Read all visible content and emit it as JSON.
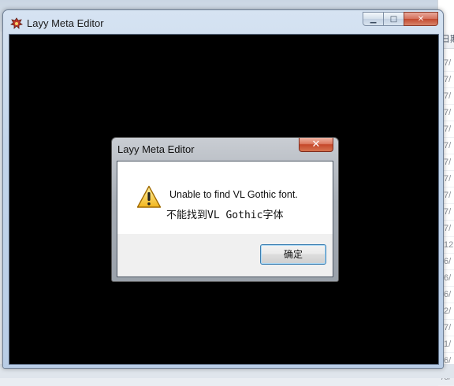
{
  "background": {
    "list_header": "日期",
    "list_rows": [
      "/7/",
      "/7/",
      "/7/",
      "/7/",
      "/7/",
      "/7/",
      "/7/",
      "/7/",
      "/7/",
      "/7/",
      "/7/",
      "/12",
      "/6/",
      "/6/",
      "/6/",
      "/2/",
      "/7/",
      "/1/",
      "/6/",
      "/6/"
    ]
  },
  "window": {
    "title": "Layy Meta Editor",
    "icon": "app-icon",
    "minimize_glyph": "▁",
    "maximize_glyph": "□",
    "close_glyph": "✕"
  },
  "dialog": {
    "title": "Layy Meta Editor",
    "close_glyph": "✕",
    "icon": "warning-icon",
    "message_en": "Unable to find VL Gothic font.",
    "message_zh": "不能找到VL Gothic字体",
    "ok_label": "确定"
  }
}
